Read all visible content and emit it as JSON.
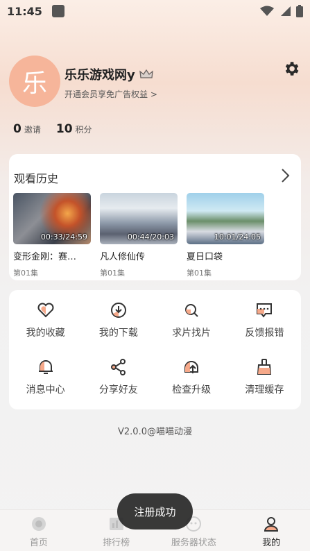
{
  "status_bar": {
    "time": "11:45"
  },
  "profile": {
    "avatar_char": "乐",
    "username": "乐乐游戏网y",
    "vip_link": "开通会员享免广告权益 >"
  },
  "stats": [
    {
      "value": "0",
      "label": "邀请"
    },
    {
      "value": "10",
      "label": "积分"
    }
  ],
  "history": {
    "title": "观看历史",
    "items": [
      {
        "name": "变形金刚：赛…",
        "time": "00:33/24:59",
        "episode": "第01集"
      },
      {
        "name": "凡人修仙传",
        "time": "00:44/20:03",
        "episode": "第01集"
      },
      {
        "name": "夏日口袋",
        "time": "10:01/24:05",
        "episode": "第01集"
      }
    ]
  },
  "menu": [
    {
      "label": "我的收藏",
      "icon": "heart-icon"
    },
    {
      "label": "我的下载",
      "icon": "download-icon"
    },
    {
      "label": "求片找片",
      "icon": "search-icon"
    },
    {
      "label": "反馈报错",
      "icon": "feedback-icon"
    },
    {
      "label": "消息中心",
      "icon": "bell-icon"
    },
    {
      "label": "分享好友",
      "icon": "share-icon"
    },
    {
      "label": "检查升级",
      "icon": "upgrade-icon"
    },
    {
      "label": "清理缓存",
      "icon": "broom-icon"
    }
  ],
  "version": "V2.0.0@喵喵动漫",
  "nav": [
    {
      "label": "首页",
      "icon": "home-icon",
      "active": false
    },
    {
      "label": "排行榜",
      "icon": "ranking-icon",
      "active": false
    },
    {
      "label": "服务器状态",
      "icon": "server-icon",
      "active": false
    },
    {
      "label": "我的",
      "icon": "profile-icon",
      "active": true
    }
  ],
  "toast": "注册成功",
  "colors": {
    "accent": "#f6b59a",
    "toast_bg": "#282828"
  }
}
